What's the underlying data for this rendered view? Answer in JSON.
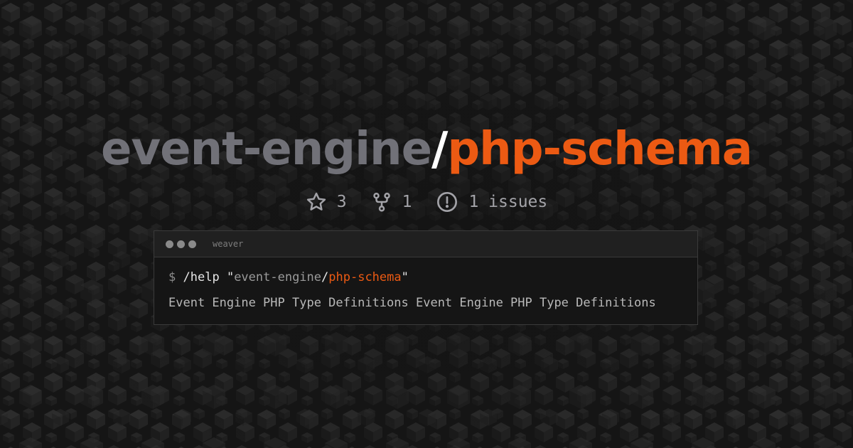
{
  "repo": {
    "owner": "event-engine",
    "separator": "/",
    "name": "php-schema"
  },
  "stats": {
    "stars": "3",
    "forks": "1",
    "issues": "1 issues"
  },
  "terminal": {
    "window_title": "weaver",
    "prompt": "$",
    "command": "/help",
    "quote_open": "\"",
    "arg_owner": "event-engine",
    "arg_separator": "/",
    "arg_repo": "php-schema",
    "quote_close": "\"",
    "description": "Event Engine PHP Type Definitions Event Engine PHP Type Definitions"
  },
  "colors": {
    "accent": "#ec5a13",
    "owner_gray": "#717178",
    "background": "#141414"
  },
  "icons": {
    "stars": "star-icon",
    "forks": "fork-icon",
    "issues": "issue-icon"
  }
}
